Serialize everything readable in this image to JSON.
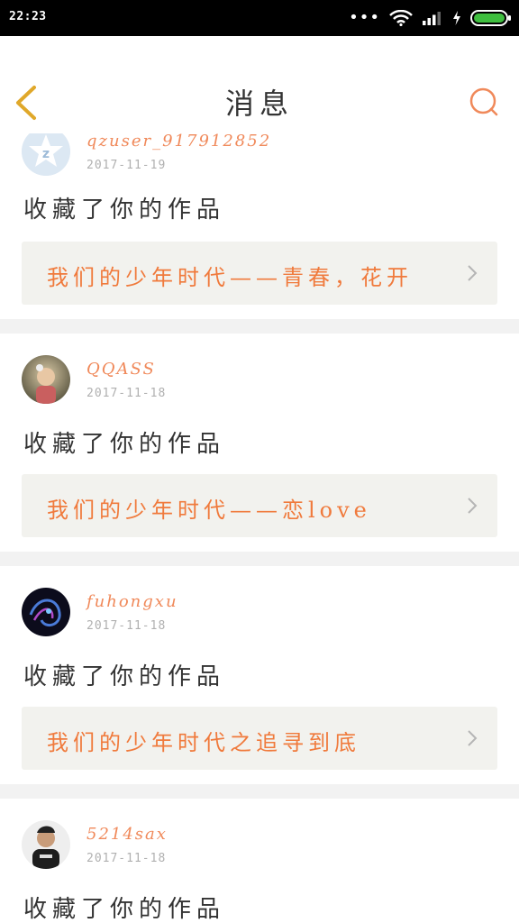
{
  "status_bar": {
    "time": "22:23",
    "icons": [
      "more-dots-icon",
      "wifi-icon",
      "signal-icon",
      "charging-icon",
      "battery-icon"
    ]
  },
  "header": {
    "title": "消息",
    "back_icon": "chevron-left-icon",
    "search_icon": "search-icon"
  },
  "colors": {
    "accent": "#f0895a",
    "work_text": "#f07a3c",
    "back_arrow": "#e0a82a",
    "card_bg": "#f2f2ee"
  },
  "messages": [
    {
      "username": "qzuser_917912852",
      "date": "2017-11-19",
      "action": "收藏了你的作品",
      "work_title": "我们的少年时代——青春，花开"
    },
    {
      "username": "QQASS",
      "date": "2017-11-18",
      "action": "收藏了你的作品",
      "work_title": "我们的少年时代——恋love"
    },
    {
      "username": "fuhongxu",
      "date": "2017-11-18",
      "action": "收藏了你的作品",
      "work_title": "我们的少年时代之追寻到底"
    },
    {
      "username": "5214sax",
      "date": "2017-11-18",
      "action": "收藏了你的作品",
      "work_title": ""
    }
  ]
}
